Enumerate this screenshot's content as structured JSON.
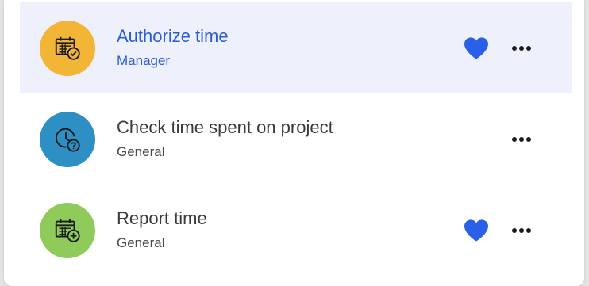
{
  "items": [
    {
      "title": "Authorize time",
      "subtitle": "Manager",
      "icon": "calendar-check-icon",
      "icon_bg": "#f2b535",
      "favorite": true,
      "active": true
    },
    {
      "title": "Check time spent on project",
      "subtitle": "General",
      "icon": "clock-question-icon",
      "icon_bg": "#2e8fc4",
      "favorite": false,
      "active": false
    },
    {
      "title": "Report time",
      "subtitle": "General",
      "icon": "calendar-add-icon",
      "icon_bg": "#8fcb5a",
      "favorite": true,
      "active": false
    }
  ],
  "colors": {
    "accent": "#2a5bdc",
    "heart": "#2a5fe8",
    "active_row_bg": "#eef1fb"
  }
}
